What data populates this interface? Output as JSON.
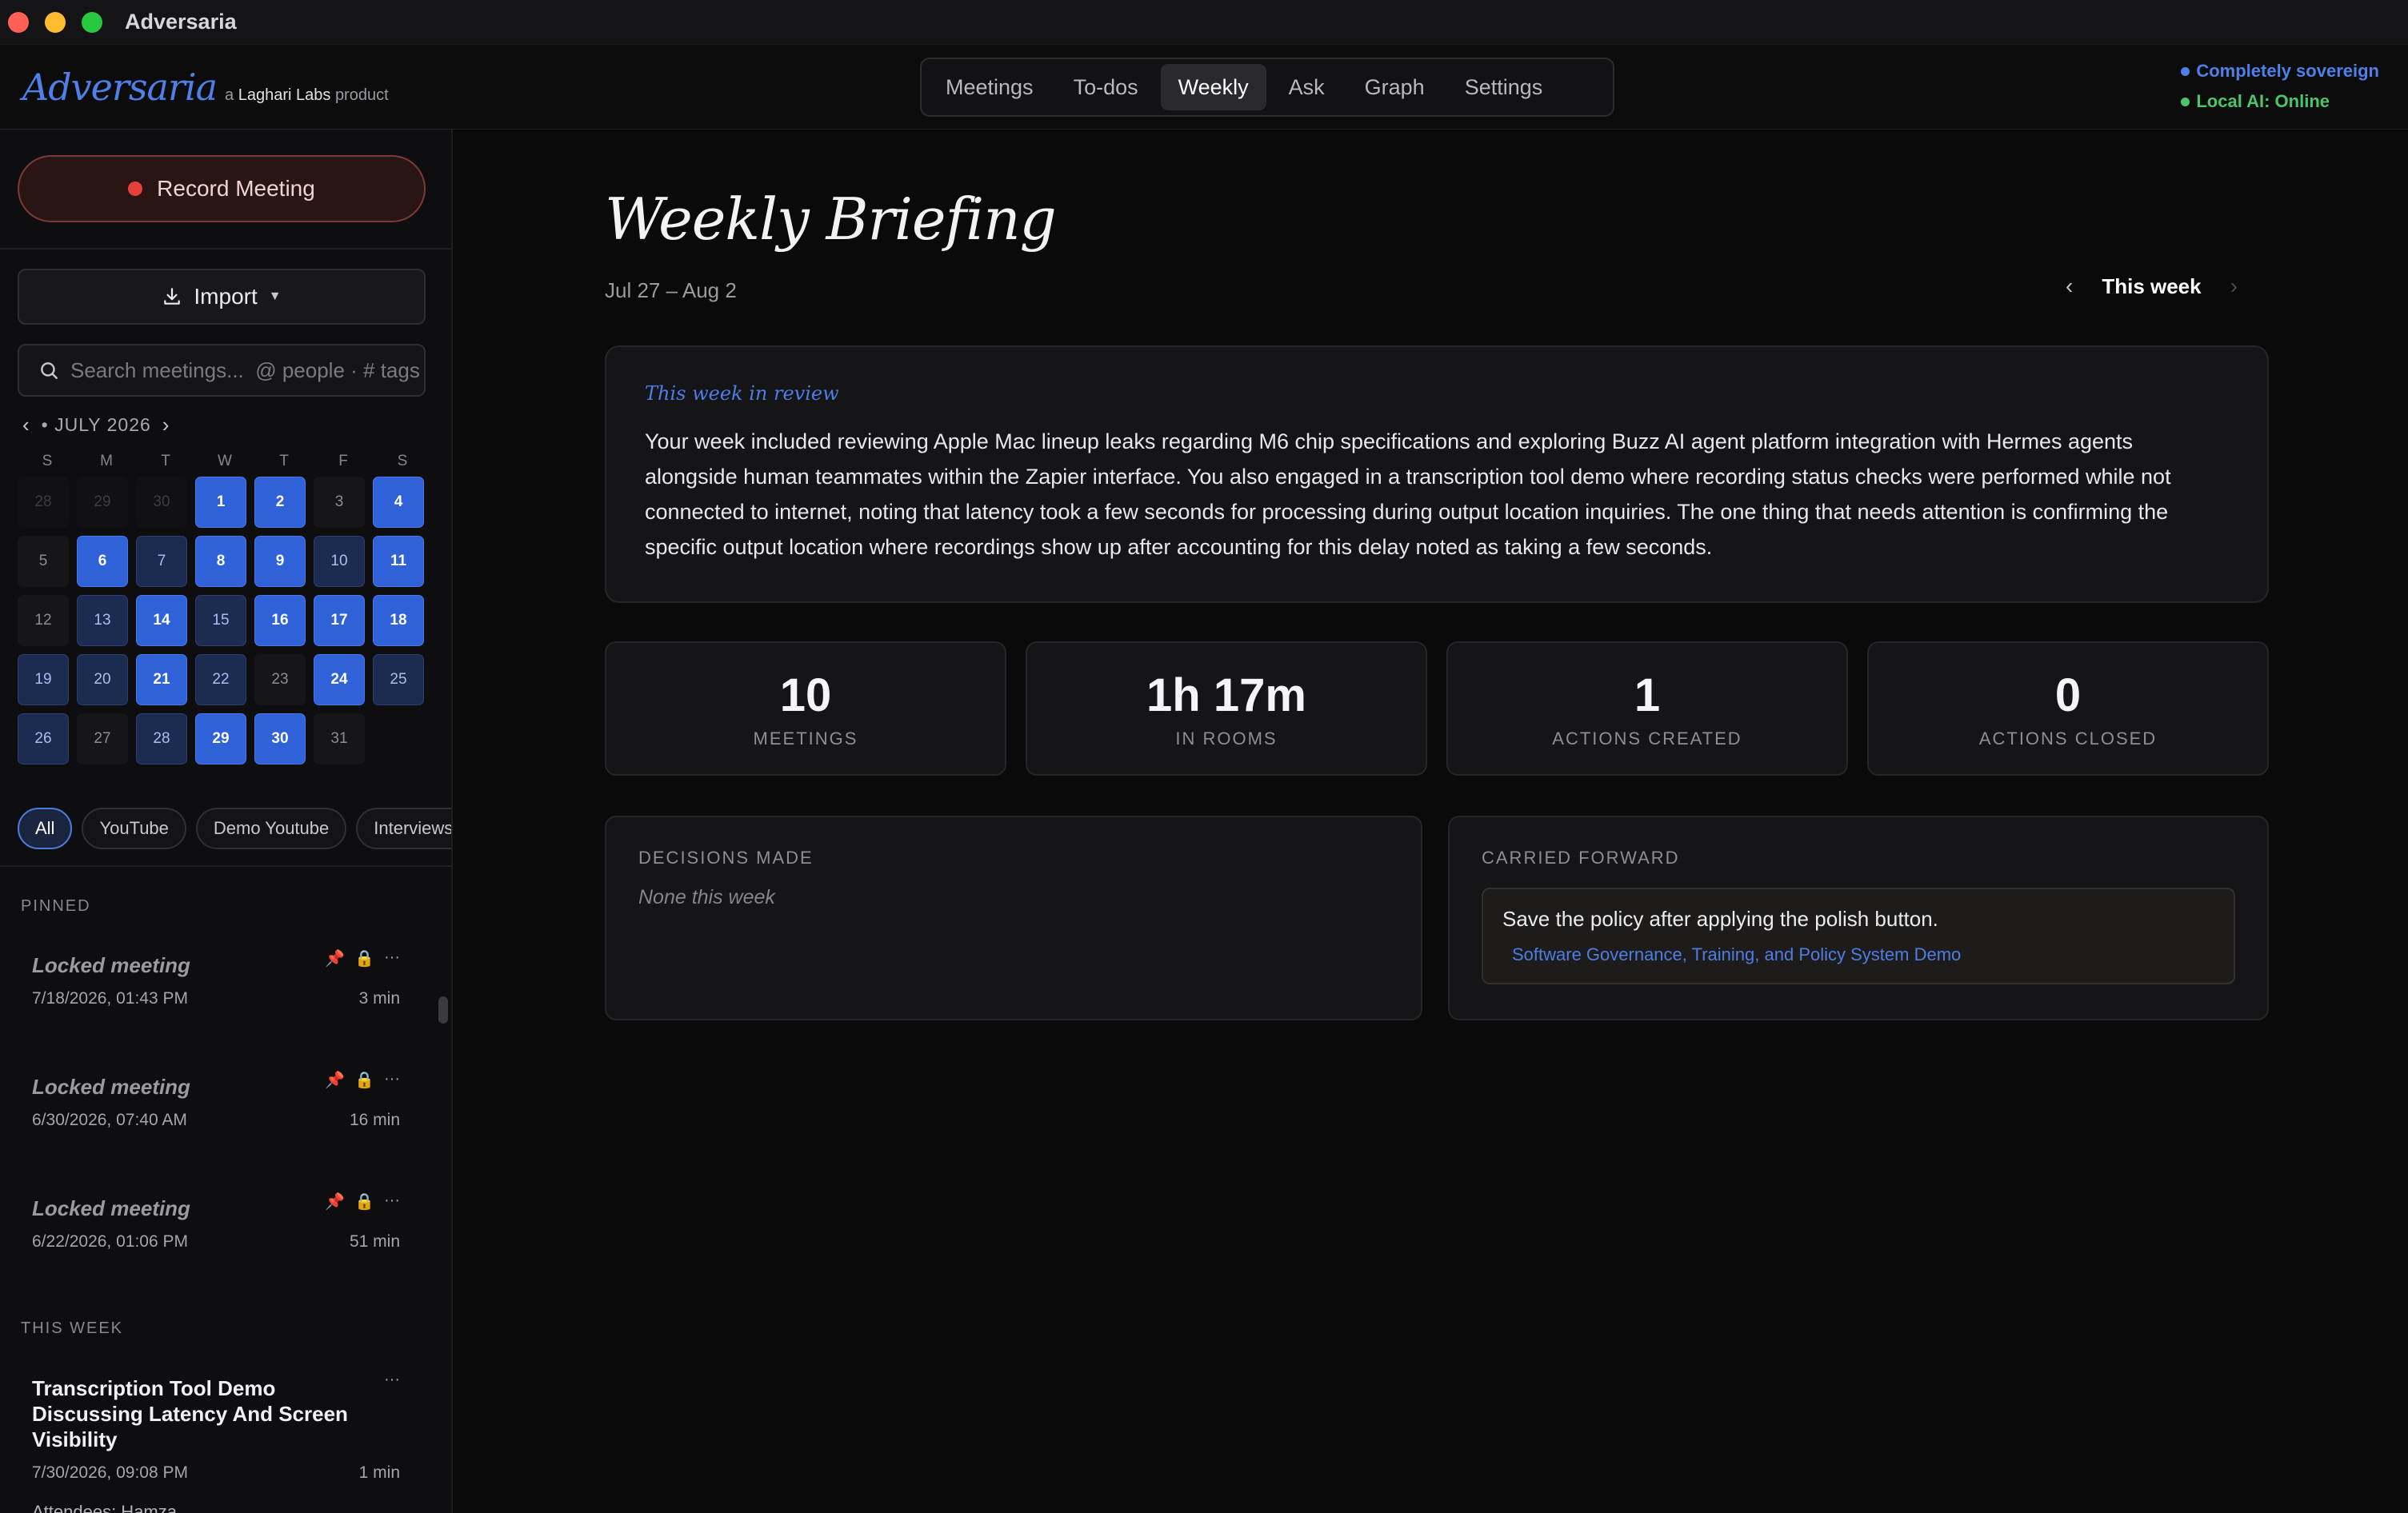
{
  "window": {
    "title": "Adversaria",
    "traffic_lights": [
      "#ff5f57",
      "#febc2e",
      "#28c840"
    ]
  },
  "brand": {
    "logo": "Adversaria",
    "tag_prefix": "a",
    "tag_company": "Laghari Labs",
    "tag_suffix": "product"
  },
  "nav": {
    "tabs": [
      "Meetings",
      "To-dos",
      "Weekly",
      "Ask",
      "Graph",
      "Settings"
    ],
    "active": "Weekly"
  },
  "status": {
    "sovereign": "Completely sovereign",
    "local_ai": "Local AI: Online",
    "sovereign_color": "#4f80e8",
    "local_ai_color": "#4cc46a"
  },
  "sidebar": {
    "record_label": "Record Meeting",
    "import_label": "Import",
    "search_placeholder": "Search meetings...  @ people · # tags",
    "calendar": {
      "month_label": "• JULY 2026",
      "weekdays": [
        "S",
        "M",
        "T",
        "W",
        "T",
        "F",
        "S"
      ],
      "days": [
        {
          "d": "28",
          "lvl": "muted"
        },
        {
          "d": "29",
          "lvl": "muted"
        },
        {
          "d": "30",
          "lvl": "muted"
        },
        {
          "d": "1",
          "lvl": "l3"
        },
        {
          "d": "2",
          "lvl": "l3"
        },
        {
          "d": "3",
          "lvl": "none"
        },
        {
          "d": "4",
          "lvl": "l3"
        },
        {
          "d": "5",
          "lvl": "none"
        },
        {
          "d": "6",
          "lvl": "l3"
        },
        {
          "d": "7",
          "lvl": "l1"
        },
        {
          "d": "8",
          "lvl": "l3"
        },
        {
          "d": "9",
          "lvl": "l3"
        },
        {
          "d": "10",
          "lvl": "l1"
        },
        {
          "d": "11",
          "lvl": "l3"
        },
        {
          "d": "12",
          "lvl": "none"
        },
        {
          "d": "13",
          "lvl": "l1"
        },
        {
          "d": "14",
          "lvl": "l3"
        },
        {
          "d": "15",
          "lvl": "l1"
        },
        {
          "d": "16",
          "lvl": "l3"
        },
        {
          "d": "17",
          "lvl": "l3"
        },
        {
          "d": "18",
          "lvl": "l3"
        },
        {
          "d": "19",
          "lvl": "l1"
        },
        {
          "d": "20",
          "lvl": "l1"
        },
        {
          "d": "21",
          "lvl": "l3"
        },
        {
          "d": "22",
          "lvl": "l1"
        },
        {
          "d": "23",
          "lvl": "none"
        },
        {
          "d": "24",
          "lvl": "l3"
        },
        {
          "d": "25",
          "lvl": "l1"
        },
        {
          "d": "26",
          "lvl": "l1"
        },
        {
          "d": "27",
          "lvl": "none"
        },
        {
          "d": "28",
          "lvl": "l1"
        },
        {
          "d": "29",
          "lvl": "l3"
        },
        {
          "d": "30",
          "lvl": "l3"
        },
        {
          "d": "31",
          "lvl": "none"
        }
      ]
    },
    "filters": [
      "All",
      "YouTube",
      "Demo Youtube",
      "Interviews"
    ],
    "active_filter": "All",
    "pinned_label": "PINNED",
    "pinned": [
      {
        "title": "Locked meeting",
        "date": "7/18/2026, 01:43 PM",
        "duration": "3 min"
      },
      {
        "title": "Locked meeting",
        "date": "6/30/2026, 07:40 AM",
        "duration": "16 min"
      },
      {
        "title": "Locked meeting",
        "date": "6/22/2026, 01:06 PM",
        "duration": "51 min"
      }
    ],
    "this_week_label": "THIS WEEK",
    "this_week": [
      {
        "title": "Transcription Tool Demo Discussing Latency And Screen Visibility",
        "date": "7/30/2026, 09:08 PM",
        "duration": "1 min",
        "attendees": "Attendees: Hamza"
      }
    ]
  },
  "weekly": {
    "title": "Weekly Briefing",
    "date_range": "Jul 27 – Aug 2",
    "week_label": "This week",
    "review_label": "This week in review",
    "review_body": "Your week included reviewing Apple Mac lineup leaks regarding M6 chip specifications and exploring Buzz AI agent platform integration with Hermes agents alongside human teammates within the Zapier interface. You also engaged in a transcription tool demo where recording status checks were performed while not connected to internet, noting that latency took a few seconds for processing during output location inquiries. The one thing that needs attention is confirming the specific output location where recordings show up after accounting for this delay noted as taking a few seconds.",
    "stats": [
      {
        "value": "10",
        "label": "MEETINGS"
      },
      {
        "value": "1h 17m",
        "label": "IN ROOMS"
      },
      {
        "value": "1",
        "label": "ACTIONS CREATED"
      },
      {
        "value": "0",
        "label": "ACTIONS CLOSED"
      }
    ],
    "decisions_label": "DECISIONS MADE",
    "decisions_empty": "None this week",
    "carried_label": "CARRIED FORWARD",
    "carried_item": "Save the policy after applying the polish button.",
    "carried_source": "Software Governance, Training, and Policy System Demo"
  }
}
